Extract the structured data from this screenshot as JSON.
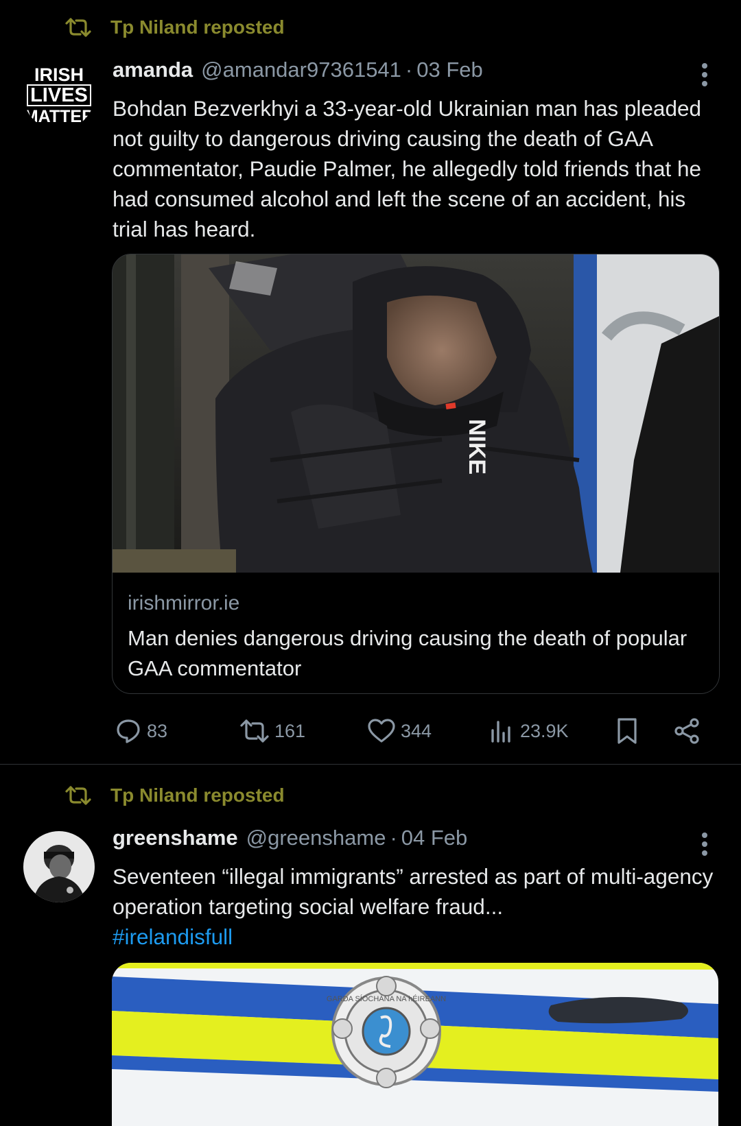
{
  "colors": {
    "background": "#000000",
    "text": "#e7e9ea",
    "muted": "#8b98a5",
    "repost": "#8a8a2e",
    "link": "#1d9bf0",
    "border": "#2f3336"
  },
  "posts": [
    {
      "repost_label": "Tp Niland reposted",
      "repost_icon": "repost-icon",
      "avatar_lines": [
        "IRISH",
        "LIVES",
        "MATTER"
      ],
      "name": "amanda",
      "handle": "@amandar97361541",
      "separator": "·",
      "date": "03 Feb",
      "more_icon": "more-vertical-icon",
      "text": "Bohdan Bezverkhyi a 33-year-old Ukrainian man has pleaded not guilty to dangerous driving causing the death of GAA commentator, Paudie Palmer, he allegedly told friends that he had consumed alcohol and left the scene of an accident, his trial has heard.",
      "card": {
        "image_text": "NIKE",
        "domain": "irishmirror.ie",
        "title": "Man denies dangerous driving causing the death of popular GAA commentator"
      },
      "actions": {
        "replies": "83",
        "reposts": "161",
        "likes": "344",
        "views": "23.9K"
      }
    },
    {
      "repost_label": "Tp Niland reposted",
      "repost_icon": "repost-icon",
      "name": "greenshame",
      "handle": "@greenshame",
      "separator": "·",
      "date": "04 Feb",
      "more_icon": "more-vertical-icon",
      "text": "Seventeen “illegal immigrants” arrested as part of multi-agency operation targeting social welfare fraud...",
      "hashtag": "#irelandisfull",
      "image_text": "GARDA SÍOCHÁNA NA hÉIREANN"
    }
  ]
}
